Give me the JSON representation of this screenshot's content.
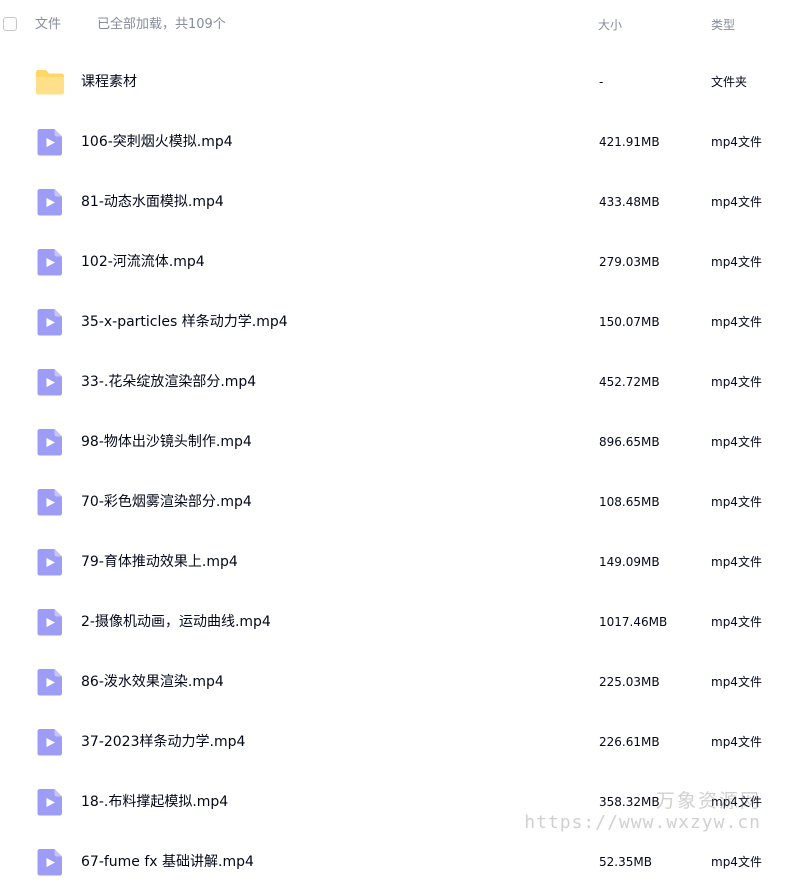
{
  "header": {
    "file_label": "文件",
    "load_status": "已全部加载，共109个",
    "size_label": "大小",
    "type_label": "类型"
  },
  "files": [
    {
      "name": "课程素材",
      "size": "-",
      "type": "文件夹",
      "icon": "folder-icon"
    },
    {
      "name": "106-突刺烟火模拟.mp4",
      "size": "421.91MB",
      "type": "mp4文件",
      "icon": "video-file-icon"
    },
    {
      "name": "81-动态水面模拟.mp4",
      "size": "433.48MB",
      "type": "mp4文件",
      "icon": "video-file-icon"
    },
    {
      "name": "102-河流流体.mp4",
      "size": "279.03MB",
      "type": "mp4文件",
      "icon": "video-file-icon"
    },
    {
      "name": "35-x-particles 样条动力学.mp4",
      "size": "150.07MB",
      "type": "mp4文件",
      "icon": "video-file-icon"
    },
    {
      "name": "33-.花朵绽放渲染部分.mp4",
      "size": "452.72MB",
      "type": "mp4文件",
      "icon": "video-file-icon"
    },
    {
      "name": "98-物体出沙镜头制作.mp4",
      "size": "896.65MB",
      "type": "mp4文件",
      "icon": "video-file-icon"
    },
    {
      "name": "70-彩色烟雾渲染部分.mp4",
      "size": "108.65MB",
      "type": "mp4文件",
      "icon": "video-file-icon"
    },
    {
      "name": "79-育体推动效果上.mp4",
      "size": "149.09MB",
      "type": "mp4文件",
      "icon": "video-file-icon"
    },
    {
      "name": "2-摄像机动画，运动曲线.mp4",
      "size": "1017.46MB",
      "type": "mp4文件",
      "icon": "video-file-icon"
    },
    {
      "name": "86-泼水效果渲染.mp4",
      "size": "225.03MB",
      "type": "mp4文件",
      "icon": "video-file-icon"
    },
    {
      "name": "37-2023样条动力学.mp4",
      "size": "226.61MB",
      "type": "mp4文件",
      "icon": "video-file-icon"
    },
    {
      "name": "18-.布料撑起模拟.mp4",
      "size": "358.32MB",
      "type": "mp4文件",
      "icon": "video-file-icon"
    },
    {
      "name": "67-fume fx 基础讲解.mp4",
      "size": "52.35MB",
      "type": "mp4文件",
      "icon": "video-file-icon"
    }
  ],
  "watermark": {
    "text_cn": "万象资源网",
    "url": "https://www.wxzyw.cn"
  },
  "colors": {
    "header_text": "#878c9c",
    "body_text": "#03081a",
    "video_icon": "#9d9cf7",
    "folder_icon": "#ffd767"
  }
}
